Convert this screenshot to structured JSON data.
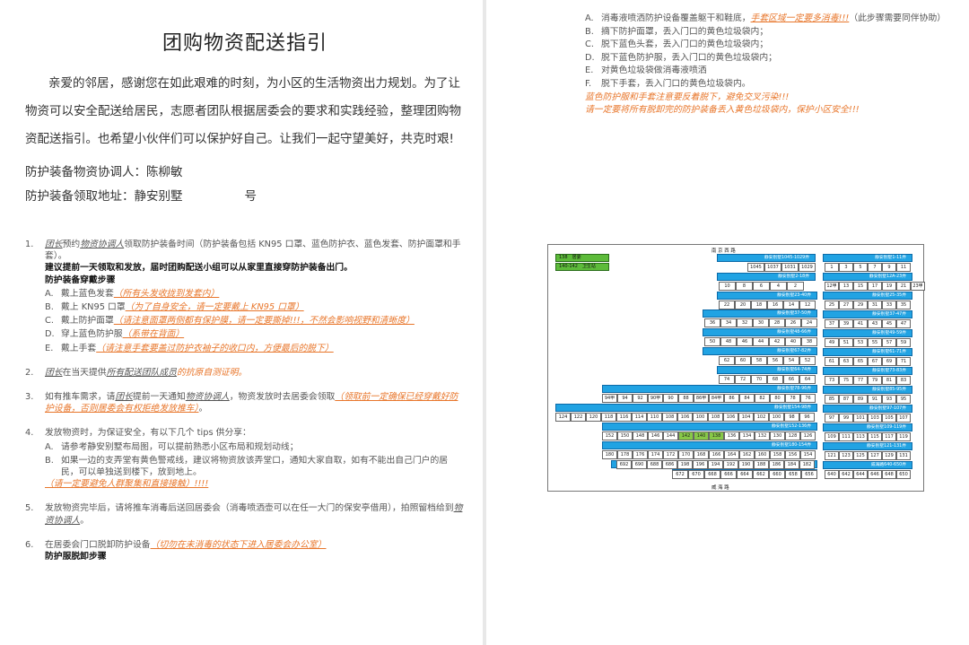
{
  "left": {
    "title": "团购物资配送指引",
    "intro_1": "亲爱的邻居，感谢您在如此艰难的时刻，为小区的生活物资出力规划。为了让物资可以安全配送给居民，志愿者团队根据居委会的要求和实践经验，整理团购物资配送指引。也希望小伙伴们可以保护好自己。让我们一起守望美好，共克时艰!",
    "coordinator": "防护装备物资协调人：陈柳敏",
    "pickup": "防护装备领取地址：静安别墅",
    "pickup_tail": "号",
    "s1_num": "1.",
    "s1_a": "团长",
    "s1_b": "预约",
    "s1_c": "物资协调人",
    "s1_d": "领取防护装备时间（防护装备包括 KN95 口罩、蓝色防护衣、蓝色发套、防护面罩和手套）。",
    "s1_bold1": "建议提前一天领取和发放，届时团购配送小组可以从家里直接穿防护装备出门。",
    "s1_bold2": "防护装备穿戴步骤",
    "s1_A_l": "A.",
    "s1_A": "戴上蓝色发套",
    "s1_A_note": "（所有头发收拢到发套内）",
    "s1_B_l": "B.",
    "s1_B": "戴上 KN95 口罩",
    "s1_B_note": "（为了自身安全，请一定要戴上 KN95 口罩）",
    "s1_C_l": "C.",
    "s1_C": "戴上防护面罩",
    "s1_C_note": "（请注意面罩两侧都有保护膜，请一定要撕掉!!!，不然会影响视野和清晰度）",
    "s1_D_l": "D.",
    "s1_D": "穿上蓝色防护服",
    "s1_D_note": "（系带在背面）",
    "s1_E_l": "E.",
    "s1_E": "戴上手套",
    "s1_E_note": "（请注意手套要盖过防护衣袖子的收口内，方便最后的脱下）",
    "s2_num": "2.",
    "s2_a": "团长",
    "s2_b": "在当天提供",
    "s2_c": "所有配送团队成员",
    "s2_d": "的抗原自测证明。",
    "s3_num": "3.",
    "s3_a": "如有推车需求，请",
    "s3_b": "团长",
    "s3_c": "提前一天通知",
    "s3_d": "物资协调人",
    "s3_e": "，物资发放时去居委会领取",
    "s3_note": "（领取前一定确保已经穿戴好防护设备，否则居委会有权拒绝发放推车）",
    "s3_end": "。",
    "s4_num": "4.",
    "s4_main": "发放物资时，为保证安全，有以下几个 tips 供分享：",
    "s4_A_l": "A.",
    "s4_A": "请参考静安别墅布局图，可以提前熟悉小区布局和规划动线；",
    "s4_B_l": "B.",
    "s4_B": "如果一边的支弄堂有黄色警戒线，建议将物资放该弄堂口，通知大家自取，如有不能出自己门户的居民，可以单独送到楼下，放到地上。",
    "s4_note": "（请一定要避免人群聚集和直接接触）!!!!",
    "s5_num": "5.",
    "s5_a": "发放物资完毕后，请将推车消毒后送回居委会（消毒喷洒壶可以在任一大门的保安亭借用），拍照留档给到",
    "s5_b": "物资协调人",
    "s5_c": "。",
    "s6_num": "6.",
    "s6_a": "在居委会门口脱卸防护设备",
    "s6_note": "（切勿在未消毒的状态下进入居委会办公室）",
    "s6_bold": "防护服脱卸步骤"
  },
  "right": {
    "A_l": "A.",
    "A": "消毒液喷洒防护设备覆盖躯干和鞋底，",
    "A_note": "手套区域一定要多消毒!!!",
    "A_tail": "（此步骤需要同伴协助）",
    "B_l": "B.",
    "B": "摘下防护面罩，丢入门口的黄色垃圾袋内；",
    "C_l": "C.",
    "C": "脱下蓝色头套，丢入门口的黄色垃圾袋内；",
    "D_l": "D.",
    "D": "脱下蓝色防护服，丢入门口的黄色垃圾袋内；",
    "E_l": "E.",
    "E": "对黄色垃圾袋做消毒液喷洒",
    "F_l": "F.",
    "F": "脱下手套，丢入门口的黄色垃圾袋内。",
    "note1": "蓝色防护服和手套注意要反着脱下，避免交叉污染!!!",
    "note2": "请一定要将所有脱卸完的防护装备丢入黄色垃圾袋内，保护小区安全!!!"
  },
  "map": {
    "top_road": "南 京 西 路",
    "bottom_road": "威 海 路",
    "legend": [
      {
        "code": "138",
        "text": "居委"
      },
      {
        "code": "140-142",
        "text": "卫生站"
      }
    ],
    "bars_left": [
      "静安别墅1045-1029弄",
      "静安别墅2-18弄",
      "静安别墅23-40弄",
      "静安别墅37-50弄",
      "静安别墅48-66弄",
      "静安别墅67-82弄",
      "静安别墅64-74弄",
      "静安别墅78-96弄",
      "静安别墅154-98弄",
      "静安别墅152-136弄",
      "静安别墅180-154弄",
      "静安别墅692-654弄",
      "威海路672-694弄"
    ],
    "bars_right": [
      "静安别墅1-11弄",
      "静安别墅12A-23弄",
      "静安别墅25-35弄",
      "静安别墅37-47弄",
      "静安别墅49-59弄",
      "静安别墅61-71弄",
      "静安别墅73-83弄",
      "静安别墅85-95弄",
      "静安别墅97-107弄",
      "静安别墅109-119弄",
      "静安别墅121-131弄",
      "威海路640-650弄"
    ],
    "row_top": [
      "1045",
      "1037",
      "1031",
      "1029"
    ],
    "row_2": [
      "10",
      "8",
      "6",
      "4",
      "2"
    ],
    "row_3": [
      "22",
      "20",
      "18",
      "16",
      "14",
      "12"
    ],
    "row_4": [
      "36",
      "34",
      "32",
      "30",
      "28",
      "26",
      "24"
    ],
    "row_5": [
      "50",
      "48",
      "46",
      "44",
      "42",
      "40",
      "38"
    ],
    "row_6": [
      "62",
      "60",
      "58",
      "56",
      "54",
      "52"
    ],
    "row_7": [
      "74",
      "72",
      "70",
      "68",
      "66",
      "64"
    ],
    "row_8": [
      "94甲",
      "94",
      "92",
      "90甲",
      "90",
      "88",
      "86甲",
      "84甲",
      "86",
      "84",
      "82",
      "80",
      "78",
      "76"
    ],
    "row_9": [
      "124",
      "122",
      "120",
      "118",
      "116",
      "114",
      "110",
      "108",
      "106",
      "100",
      "108",
      "106",
      "104",
      "102",
      "100",
      "98",
      "96"
    ],
    "row_10": [
      "152",
      "150",
      "148",
      "146",
      "144",
      "142",
      "140",
      "138",
      "136",
      "134",
      "132",
      "130",
      "128",
      "126"
    ],
    "row_11": [
      "180",
      "178",
      "176",
      "174",
      "172",
      "170",
      "168",
      "166",
      "164",
      "162",
      "160",
      "158",
      "156",
      "154"
    ],
    "row_12": [
      "692",
      "690",
      "688",
      "686",
      "198",
      "196",
      "194",
      "192",
      "190",
      "188",
      "186",
      "184",
      "182"
    ],
    "row_13": [
      "672",
      "670",
      "668",
      "666",
      "664",
      "662",
      "660",
      "658",
      "656"
    ],
    "r_row1": [
      "1",
      "3",
      "5",
      "7",
      "9",
      "11"
    ],
    "r_row2": [
      "12甲",
      "13",
      "15",
      "17",
      "19",
      "21",
      "23甲"
    ],
    "r_row3": [
      "25",
      "27",
      "29",
      "31",
      "33",
      "35"
    ],
    "r_row4": [
      "37",
      "39",
      "41",
      "43",
      "45",
      "47"
    ],
    "r_row5": [
      "49",
      "51",
      "53",
      "55",
      "57",
      "59"
    ],
    "r_row6": [
      "61",
      "63",
      "65",
      "67",
      "69",
      "71"
    ],
    "r_row7": [
      "73",
      "75",
      "77",
      "79",
      "81",
      "83"
    ],
    "r_row8": [
      "85",
      "87",
      "89",
      "91",
      "93",
      "95"
    ],
    "r_row9": [
      "97",
      "99",
      "101",
      "103",
      "105",
      "107"
    ],
    "r_row10": [
      "109",
      "111",
      "113",
      "115",
      "117",
      "119"
    ],
    "r_row11": [
      "121",
      "123",
      "125",
      "127",
      "129",
      "131"
    ],
    "r_row12": [
      "640",
      "642",
      "644",
      "646",
      "648",
      "650"
    ]
  },
  "colors": {
    "accent_orange": "#e8762b",
    "map_bar_blue": "#21a3e3",
    "map_highlight_green": "#87c848"
  }
}
